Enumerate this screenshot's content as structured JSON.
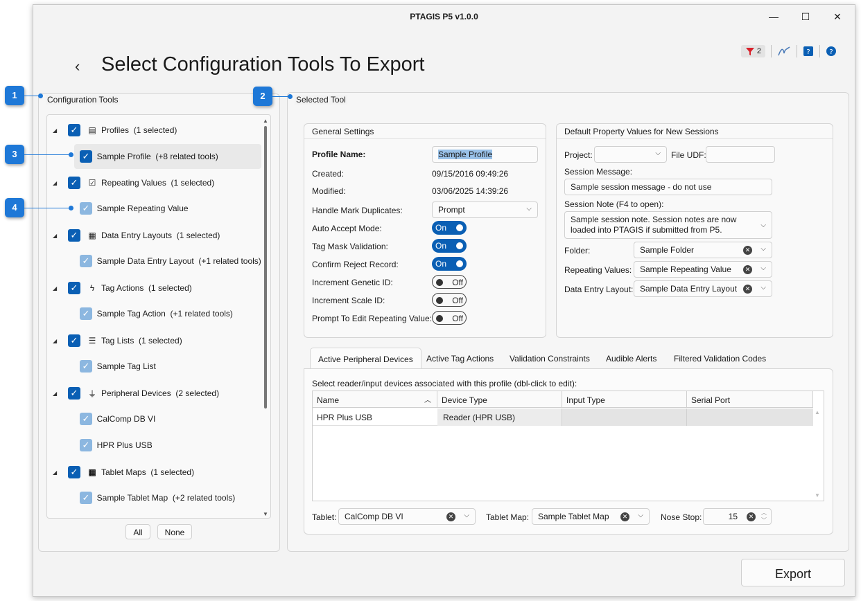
{
  "window": {
    "title": "PTAGIS P5 v1.0.0",
    "min": "—",
    "max": "☐",
    "close": "✕"
  },
  "header": {
    "back": "‹",
    "title": "Select Configuration Tools To Export",
    "filter_count": "2"
  },
  "callouts": [
    "1",
    "2",
    "3",
    "4"
  ],
  "left": {
    "group_label": "Configuration Tools",
    "tree": [
      {
        "label": "Profiles",
        "count": "(1 selected)",
        "child": "Sample Profile",
        "child_extra": "(+8 related tools)"
      },
      {
        "label": "Repeating Values",
        "count": "(1 selected)",
        "child": "Sample Repeating Value",
        "child_extra": ""
      },
      {
        "label": "Data Entry Layouts",
        "count": "(1 selected)",
        "child": "Sample Data Entry Layout",
        "child_extra": "(+1 related tools)"
      },
      {
        "label": "Tag Actions",
        "count": "(1 selected)",
        "child": "Sample Tag Action",
        "child_extra": "(+1 related tools)"
      },
      {
        "label": "Tag Lists",
        "count": "(1 selected)",
        "child": "Sample Tag List",
        "child_extra": ""
      },
      {
        "label": "Peripheral Devices",
        "count": "(2 selected)",
        "child": "CalComp DB VI",
        "child2": "HPR Plus USB"
      },
      {
        "label": "Tablet Maps",
        "count": "(1 selected)",
        "child": "Sample Tablet Map",
        "child_extra": "(+2 related tools)"
      }
    ],
    "all_btn": "All",
    "none_btn": "None"
  },
  "right": {
    "group_label": "Selected Tool",
    "general": {
      "heading": "General Settings",
      "profile_name_label": "Profile Name:",
      "profile_name": "Sample Profile",
      "created_label": "Created:",
      "created": "09/15/2016 09:49:26",
      "modified_label": "Modified:",
      "modified": "03/06/2025 14:39:26",
      "handle_label": "Handle Mark Duplicates:",
      "handle_value": "Prompt",
      "auto_accept_label": "Auto Accept Mode:",
      "tag_mask_label": "Tag Mask Validation:",
      "confirm_reject_label": "Confirm Reject Record:",
      "inc_genetic_label": "Increment Genetic ID:",
      "inc_scale_label": "Increment Scale ID:",
      "prompt_edit_label": "Prompt To Edit Repeating Value:",
      "on": "On",
      "off": "Off"
    },
    "defaults": {
      "heading": "Default Property Values for New Sessions",
      "project_label": "Project:",
      "file_udf_label": "File UDF:",
      "session_message_label": "Session Message:",
      "session_message": "Sample session message - do not use",
      "session_note_label": "Session Note (F4 to open):",
      "session_note": "Sample session note. Session notes are now loaded into PTAGIS if submitted from P5.",
      "folder_label": "Folder:",
      "folder": "Sample Folder",
      "repeating_label": "Repeating Values:",
      "repeating": "Sample Repeating Value",
      "layout_label": "Data Entry Layout:",
      "layout": "Sample Data Entry Layout"
    },
    "tabs": [
      "Active Peripheral Devices",
      "Active Tag Actions",
      "Validation Constraints",
      "Audible Alerts",
      "Filtered Validation Codes"
    ],
    "devices": {
      "hint": "Select reader/input devices associated with this profile (dbl-click to edit):",
      "columns": [
        "Name",
        "Device Type",
        "Input Type",
        "Serial Port"
      ],
      "rows": [
        {
          "name": "HPR Plus USB",
          "type": "Reader (HPR USB)",
          "input": "",
          "port": ""
        }
      ],
      "tablet_label": "Tablet:",
      "tablet": "CalComp DB VI",
      "tablet_map_label": "Tablet Map:",
      "tablet_map": "Sample Tablet Map",
      "nose_stop_label": "Nose Stop:",
      "nose_stop": "15"
    }
  },
  "export_btn": "Export"
}
